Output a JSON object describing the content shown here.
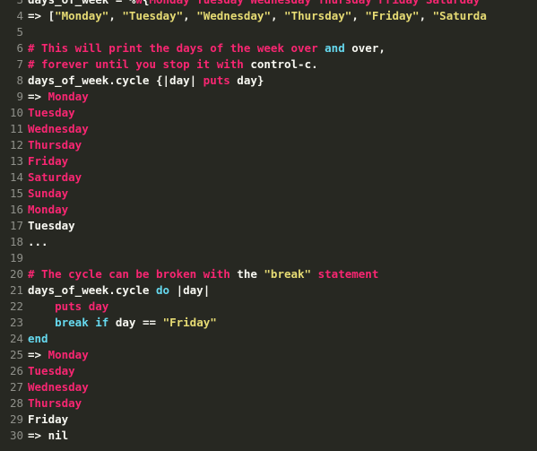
{
  "colors": {
    "background": "#272822",
    "default_text": "#f8f8f2",
    "keyword": "#f92672",
    "string": "#e6db74",
    "builtin": "#66d9ef",
    "line_number": "#8f908a"
  },
  "lines": [
    {
      "num": "3",
      "tokens": [
        {
          "text": "days_of_week = %",
          "cls": "t-default"
        },
        {
          "text": "w",
          "cls": "t-keyword"
        },
        {
          "text": "{",
          "cls": "t-default"
        },
        {
          "text": "Monday Tuesday Wednesday Thursday Friday Saturday",
          "cls": "t-keyword"
        }
      ]
    },
    {
      "num": "4",
      "tokens": [
        {
          "text": "=> [",
          "cls": "t-default"
        },
        {
          "text": "\"Monday\"",
          "cls": "t-string"
        },
        {
          "text": ", ",
          "cls": "t-default"
        },
        {
          "text": "\"Tuesday\"",
          "cls": "t-string"
        },
        {
          "text": ", ",
          "cls": "t-default"
        },
        {
          "text": "\"Wednesday\"",
          "cls": "t-string"
        },
        {
          "text": ", ",
          "cls": "t-default"
        },
        {
          "text": "\"Thursday\"",
          "cls": "t-string"
        },
        {
          "text": ", ",
          "cls": "t-default"
        },
        {
          "text": "\"Friday\"",
          "cls": "t-string"
        },
        {
          "text": ", ",
          "cls": "t-default"
        },
        {
          "text": "\"Saturda",
          "cls": "t-string"
        }
      ]
    },
    {
      "num": "5",
      "tokens": []
    },
    {
      "num": "6",
      "tokens": [
        {
          "text": "# This will print the days of the week over ",
          "cls": "t-keyword"
        },
        {
          "text": "and",
          "cls": "t-builtin"
        },
        {
          "text": " over,",
          "cls": "t-default"
        }
      ]
    },
    {
      "num": "7",
      "tokens": [
        {
          "text": "# forever until you stop it with ",
          "cls": "t-keyword"
        },
        {
          "text": "control-c.",
          "cls": "t-default"
        }
      ]
    },
    {
      "num": "8",
      "tokens": [
        {
          "text": "days_of_week.cycle {|day| ",
          "cls": "t-default"
        },
        {
          "text": "puts",
          "cls": "t-keyword"
        },
        {
          "text": " day}",
          "cls": "t-default"
        }
      ]
    },
    {
      "num": "9",
      "tokens": [
        {
          "text": "=> ",
          "cls": "t-default"
        },
        {
          "text": "Monday",
          "cls": "t-keyword"
        }
      ]
    },
    {
      "num": "10",
      "tokens": [
        {
          "text": "Tuesday",
          "cls": "t-keyword"
        }
      ]
    },
    {
      "num": "11",
      "tokens": [
        {
          "text": "Wednesday",
          "cls": "t-keyword"
        }
      ]
    },
    {
      "num": "12",
      "tokens": [
        {
          "text": "Thursday",
          "cls": "t-keyword"
        }
      ]
    },
    {
      "num": "13",
      "tokens": [
        {
          "text": "Friday",
          "cls": "t-keyword"
        }
      ]
    },
    {
      "num": "14",
      "tokens": [
        {
          "text": "Saturday",
          "cls": "t-keyword"
        }
      ]
    },
    {
      "num": "15",
      "tokens": [
        {
          "text": "Sunday",
          "cls": "t-keyword"
        }
      ]
    },
    {
      "num": "16",
      "tokens": [
        {
          "text": "Monday",
          "cls": "t-keyword"
        }
      ]
    },
    {
      "num": "17",
      "tokens": [
        {
          "text": "Tuesday",
          "cls": "t-default"
        }
      ]
    },
    {
      "num": "18",
      "tokens": [
        {
          "text": "...",
          "cls": "t-default"
        }
      ]
    },
    {
      "num": "19",
      "tokens": []
    },
    {
      "num": "20",
      "tokens": [
        {
          "text": "# The cycle can be broken with ",
          "cls": "t-keyword"
        },
        {
          "text": "the ",
          "cls": "t-default"
        },
        {
          "text": "\"break\"",
          "cls": "t-string"
        },
        {
          "text": " statement",
          "cls": "t-keyword"
        }
      ]
    },
    {
      "num": "21",
      "tokens": [
        {
          "text": "days_of_week.cycle ",
          "cls": "t-default"
        },
        {
          "text": "do",
          "cls": "t-builtin"
        },
        {
          "text": " |day|",
          "cls": "t-default"
        }
      ]
    },
    {
      "num": "22",
      "tokens": [
        {
          "text": "    ",
          "cls": "t-default"
        },
        {
          "text": "puts day",
          "cls": "t-keyword"
        }
      ]
    },
    {
      "num": "23",
      "tokens": [
        {
          "text": "    ",
          "cls": "t-default"
        },
        {
          "text": "break",
          "cls": "t-builtin"
        },
        {
          "text": " ",
          "cls": "t-default"
        },
        {
          "text": "if",
          "cls": "t-builtin"
        },
        {
          "text": " day == ",
          "cls": "t-default"
        },
        {
          "text": "\"Friday\"",
          "cls": "t-string"
        }
      ]
    },
    {
      "num": "24",
      "tokens": [
        {
          "text": "end",
          "cls": "t-builtin"
        }
      ]
    },
    {
      "num": "25",
      "tokens": [
        {
          "text": "=> ",
          "cls": "t-default"
        },
        {
          "text": "Monday",
          "cls": "t-keyword"
        }
      ]
    },
    {
      "num": "26",
      "tokens": [
        {
          "text": "Tuesday",
          "cls": "t-keyword"
        }
      ]
    },
    {
      "num": "27",
      "tokens": [
        {
          "text": "Wednesday",
          "cls": "t-keyword"
        }
      ]
    },
    {
      "num": "28",
      "tokens": [
        {
          "text": "Thursday",
          "cls": "t-keyword"
        }
      ]
    },
    {
      "num": "29",
      "tokens": [
        {
          "text": "Friday",
          "cls": "t-default"
        }
      ]
    },
    {
      "num": "30",
      "tokens": [
        {
          "text": "=> nil",
          "cls": "t-default"
        }
      ]
    }
  ]
}
